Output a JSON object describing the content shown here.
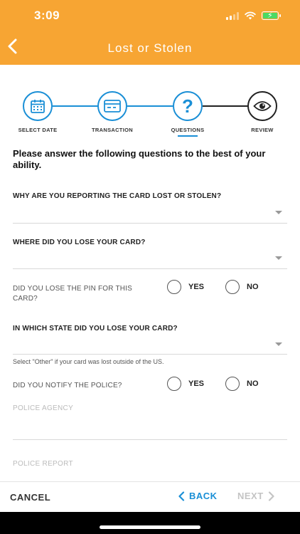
{
  "status_bar": {
    "time": "3:09"
  },
  "header": {
    "title": "Lost or Stolen"
  },
  "stepper": {
    "steps": [
      {
        "label": "SELECT DATE",
        "icon": "calendar-icon"
      },
      {
        "label": "TRANSACTION",
        "icon": "credit-card-icon"
      },
      {
        "label": "QUESTIONS",
        "icon": "question-icon"
      },
      {
        "label": "REVIEW",
        "icon": "eye-icon"
      }
    ],
    "active_step": "QUESTIONS",
    "colors": {
      "done": "#1a8fd6",
      "pending": "#222222"
    }
  },
  "intro": "Please answer the following questions to the best of your ability.",
  "questions": {
    "reason": {
      "label": "WHY ARE YOU REPORTING THE CARD LOST OR STOLEN?",
      "value": ""
    },
    "where": {
      "label": "WHERE DID YOU LOSE YOUR CARD?",
      "value": ""
    },
    "pin": {
      "label": "DID YOU LOSE THE PIN FOR THIS CARD?",
      "yes": "YES",
      "no": "NO"
    },
    "state": {
      "label": "IN WHICH STATE DID YOU LOSE YOUR CARD?",
      "value": "",
      "hint": "Select \"Other\" if your card was lost outside of the US."
    },
    "police": {
      "label": "DID YOU NOTIFY THE POLICE?",
      "yes": "YES",
      "no": "NO"
    },
    "agency": {
      "label": "POLICE AGENCY",
      "value": ""
    },
    "report": {
      "label": "POLICE REPORT",
      "value": ""
    }
  },
  "footer": {
    "cancel": "CANCEL",
    "back": "BACK",
    "next": "NEXT"
  },
  "theme": {
    "accent": "#f7a533",
    "link": "#1a8fd6"
  }
}
